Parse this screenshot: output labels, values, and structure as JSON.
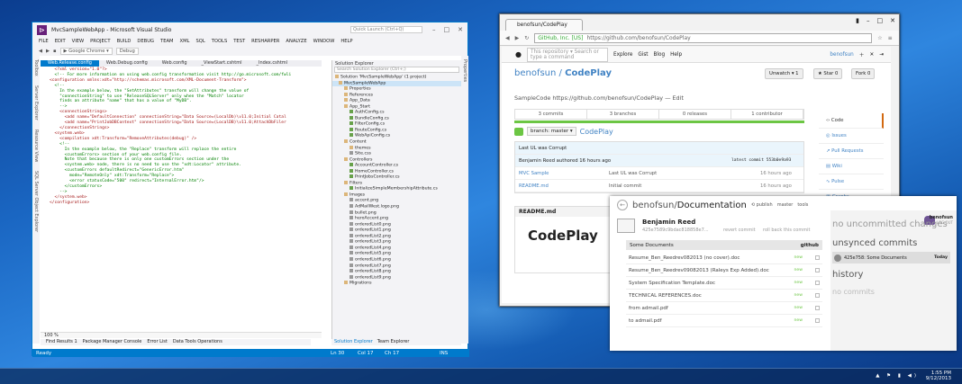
{
  "vs": {
    "title": "MvcSampleWebApp - Microsoft Visual Studio",
    "quick": "Quick Launch (Ctrl+Q)",
    "menu": [
      "FILE",
      "EDIT",
      "VIEW",
      "PROJECT",
      "BUILD",
      "DEBUG",
      "TEAM",
      "XML",
      "SQL",
      "TOOLS",
      "TEST",
      "RESHARPER",
      "ANALYZE",
      "WINDOW",
      "HELP"
    ],
    "toolbar": {
      "run": "▶ Google Chrome ▾",
      "config": "Debug"
    },
    "left_tabs": [
      "Toolbox",
      "Server Explorer",
      "Resource View",
      "SQL Server Object Explorer"
    ],
    "right_tab": "Properties",
    "tabs": [
      "Web.Release.config",
      "Web.Debug.config",
      "Web.config",
      "_ViewStart.cshtml",
      "_Index.cshtml"
    ],
    "code": [
      "  <?xml version=\"1.0\"?>",
      "",
      "  <!-- For more information on using web.config transformation visit http://go.microsoft.com/fwli",
      "",
      "<configuration xmlns:xdt=\"http://schemas.microsoft.com/XML-Document-Transform\">",
      "  <!--",
      "    In the example below, the \"SetAttributes\" transform will change the value of",
      "    \"connectionString\" to use \"ReleaseSQLServer\" only when the \"Match\" locator",
      "    finds an attribute \"name\" that has a value of \"MyDB\".",
      "    -->",
      "    <connectionStrings>",
      "      <add name=\"DefaultConnection\" connectionString=\"Data Source=(LocalDb)\\v11.0;Initial Catal",
      "      <add name=\"PrintJobDBContext\" connectionString=\"Data Source=(LocalDB)\\v11.0;AttachDbFiler",
      "    </connectionStrings>",
      "",
      "  <system.web>",
      "    <compilation xdt:Transform=\"RemoveAttributes(debug)\" />",
      "    <!--",
      "      In the example below, the \"Replace\" transform will replace the entire",
      "      <customErrors> section of your web.config file.",
      "      Note that because there is only one customErrors section under the",
      "      <system.web> node, there is no need to use the \"xdt:Locator\" attribute.",
      "",
      "      <customErrors defaultRedirect=\"GenericError.htm\"",
      "        mode=\"RemoteOnly\" xdt:Transform=\"Replace\">",
      "        <error statusCode=\"500\" redirect=\"InternalError.htm\"/>",
      "      </customErrors>",
      "    -->",
      "  </system.web>",
      "</configuration>"
    ],
    "zoom": "100 %",
    "se_title": "Solution Explorer",
    "se_search": "Search Solution Explorer (Ctrl+;)",
    "se_items": [
      "Solution 'MvcSampleWebApp' (1 project)",
      "MvcSampleWebApp",
      "Properties",
      "References",
      "App_Data",
      "App_Start",
      "AuthConfig.cs",
      "BundleConfig.cs",
      "FilterConfig.cs",
      "RouteConfig.cs",
      "WebApiConfig.cs",
      "Content",
      "themes",
      "Site.css",
      "Controllers",
      "AccountController.cs",
      "HomeController.cs",
      "PrintJobsController.cs",
      "Filters",
      "InitializeSimpleMembershipAttribute.cs",
      "Images",
      "accent.png",
      "AdMailWest.logo.png",
      "bullet.png",
      "heroAccent.png",
      "orderedList0.png",
      "orderedList1.png",
      "orderedList2.png",
      "orderedList3.png",
      "orderedList4.png",
      "orderedList5.png",
      "orderedList6.png",
      "orderedList7.png",
      "orderedList8.png",
      "orderedList9.png",
      "Migrations"
    ],
    "se_tabs": [
      "Solution Explorer",
      "Team Explorer"
    ],
    "bottom_tabs": [
      "Find Results 1",
      "Package Manager Console",
      "Error List",
      "Data Tools Operations"
    ],
    "status": {
      "ready": "Ready",
      "ln": "Ln 30",
      "col": "Col 17",
      "ch": "Ch 17",
      "ins": "INS"
    }
  },
  "browser": {
    "tab": "benofsun/CodePlay",
    "cert": "GitHub, Inc. [US]",
    "url": "https://github.com/benofsun/CodePlay",
    "gh": {
      "search": "This repository ▾ Search or type a command",
      "nav": [
        "Explore",
        "Gist",
        "Blog",
        "Help"
      ],
      "user": "benofsun",
      "owner": "benofsun",
      "repo": "CodePlay",
      "unwatch": "Unwatch ▾ 1",
      "star": "★ Star 0",
      "fork": "Fork 0",
      "desc": "SampleCode https://github.com/benofsun/CodePlay — Edit",
      "stats": [
        "3 commits",
        "3 branches",
        "0 releases",
        "1 contributor"
      ],
      "branch": "branch: master ▾",
      "repo_path": "CodePlay",
      "last_msg": "Last UL was Corrupt",
      "last_author": "Benjamin Reed authored 16 hours ago",
      "latest": "latest commit 553b0e9a93",
      "files": [
        {
          "name": "MVC Sample",
          "msg": "Last UL was Corrupt",
          "age": "16 hours ago"
        },
        {
          "name": "README.md",
          "msg": "Initial commit",
          "age": "16 hours ago"
        }
      ],
      "readme_title": "README.md",
      "readme_h": "CodePlay",
      "side": [
        "Code",
        "Issues",
        "Pull Requests",
        "Wiki",
        "Pulse",
        "Graphs"
      ]
    }
  },
  "ghapp": {
    "owner": "benofsun",
    "repo": "Documentation",
    "tabs": [
      "⟲ publish",
      "master",
      "tools"
    ],
    "author": "Benjamin Reed",
    "sha": "425e7589c9bdac818858e7...",
    "revert": "revert commit",
    "rollback": "roll back this commit",
    "section": "Some Documents",
    "gh": "github",
    "files": [
      "Resume_Ben_Reedrev082013 (no cover).doc",
      "Resume_Ben_Reedrev09082013 (Raleys Exp Added).doc",
      "System Specification Template.doc",
      "TECHNICAL REFERENCES.doc",
      "from admail.pdf",
      "to admail.pdf"
    ],
    "new": "new",
    "user": "benofsun",
    "logout": "LOG OUT",
    "no_unc": "no uncommitted changes",
    "unsynced": "unsynced commits",
    "sync_item": "425e758: Some Documents",
    "today": "Today",
    "history": "history",
    "no_commits": "no commits"
  },
  "tray": {
    "time": "1:55 PM",
    "date": "9/12/2013"
  }
}
